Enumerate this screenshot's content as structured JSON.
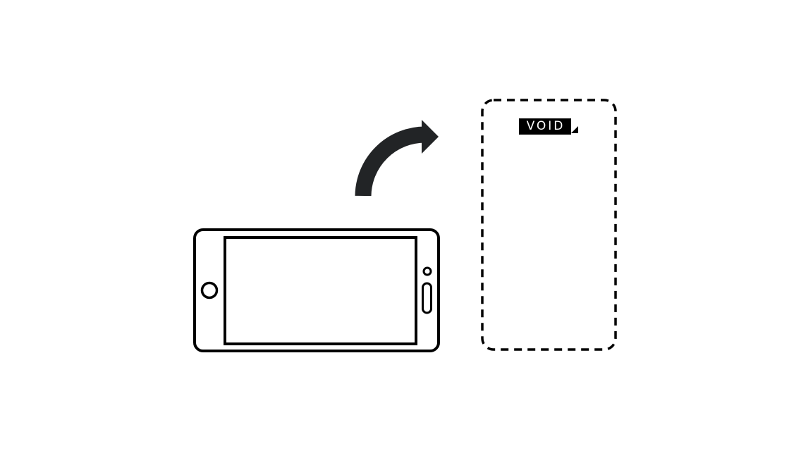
{
  "logo": {
    "text": "VOID"
  },
  "colors": {
    "outline": "#000000",
    "arrow": "#222426",
    "background": "#ffffff"
  },
  "icons": {
    "landscape_phone": "phone-landscape-icon",
    "rotate_arrow": "curved-arrow-icon",
    "portrait_placeholder": "dashed-portrait-frame"
  }
}
